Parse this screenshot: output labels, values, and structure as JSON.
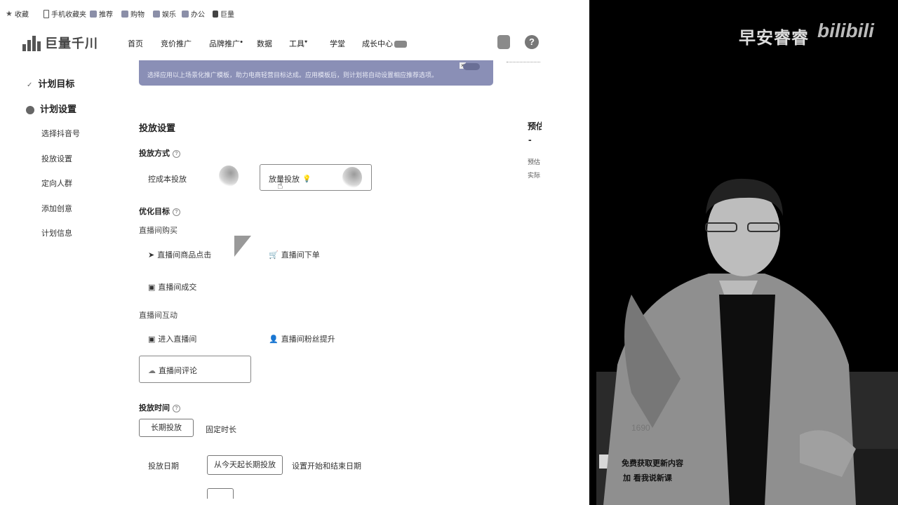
{
  "bookmarks": [
    {
      "label": "收藏",
      "icon": "star-icon"
    },
    {
      "label": "手机收藏夹",
      "icon": "phone-icon"
    },
    {
      "label": "推荐",
      "icon": "folder-icon"
    },
    {
      "label": "购物",
      "icon": "folder-icon"
    },
    {
      "label": "娱乐",
      "icon": "folder-icon"
    },
    {
      "label": "办公",
      "icon": "folder-icon"
    },
    {
      "label": "巨量",
      "icon": "file-icon"
    }
  ],
  "logo": {
    "text": "巨量千川"
  },
  "nav": [
    {
      "label": "首页",
      "badge": ""
    },
    {
      "label": "竞价推广",
      "badge": ""
    },
    {
      "label": "品牌推广",
      "badge": "●"
    },
    {
      "label": "数据",
      "badge": ""
    },
    {
      "label": "工具",
      "badge": "♥"
    },
    {
      "label": "学堂",
      "badge": ""
    },
    {
      "label": "成长中心",
      "badge": "💬"
    }
  ],
  "header_icons": {
    "help": "?"
  },
  "sidebar": {
    "steps": [
      {
        "label": "计划目标",
        "icon": "check-icon"
      },
      {
        "label": "计划设置",
        "icon": "step-dot-icon"
      }
    ],
    "items": [
      "选择抖音号",
      "投放设置",
      "定向人群",
      "添加创意",
      "计划信息"
    ]
  },
  "banner": {
    "text": "选择应用以上场景化推广模板，助力电商轻营目标达成。应用模板后，则计划将自动设置相应推荐选项。",
    "close": "×"
  },
  "delivery": {
    "section_title": "投放设置",
    "mode_label": "投放方式",
    "modes": [
      "控成本投放",
      "放量投放"
    ],
    "goal_label": "优化目标",
    "group1_label": "直播间购买",
    "group1_options": [
      "直播间商品点击",
      "直播间下单",
      "直播间成交"
    ],
    "group2_label": "直播间互动",
    "group2_options": [
      "进入直播间",
      "直播间粉丝提升",
      "直播间评论"
    ],
    "time_label": "投放时间",
    "time_options": [
      "长期投放",
      "固定时长"
    ],
    "date_label": "投放日期",
    "date_options": [
      "从今天起长期投放",
      "设置开始和结束日期"
    ]
  },
  "right_summary": {
    "title": "预估",
    "dash": "-",
    "line1": "预估",
    "line2": "实际"
  },
  "video_overlay": {
    "watermark": "早安睿睿",
    "platform": "bilibili",
    "phone": "1690",
    "caption1": "免费获取更新内容",
    "caption2": "加 看我说新课"
  }
}
